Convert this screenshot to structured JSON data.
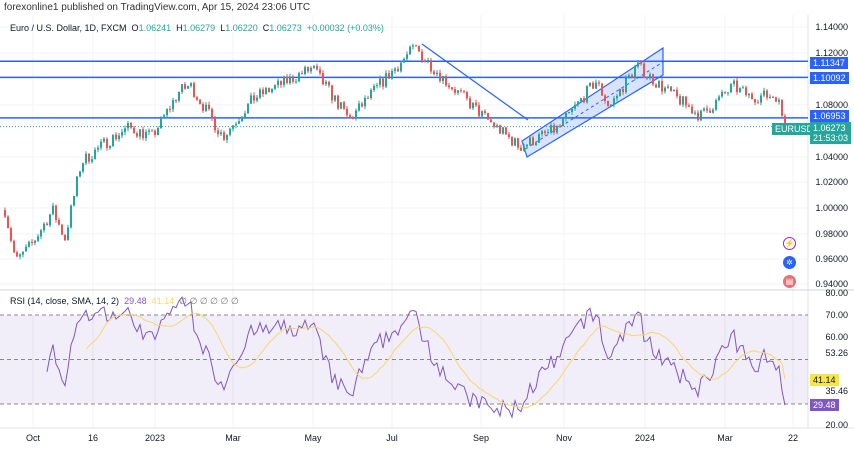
{
  "header": {
    "published": "forexonline1 published on TradingView.com, Apr 15, 2024 23:06 UTC"
  },
  "legend": {
    "symbol": "Euro / U.S. Dollar, 1D, FXCM",
    "o_label": "O",
    "o": "1.06241",
    "h_label": "H",
    "h": "1.06279",
    "l_label": "L",
    "l": "1.06220",
    "c_label": "C",
    "c": "1.06273",
    "change": "+0.00032 (+0.03%)"
  },
  "rsi_legend": {
    "label": "RSI (14, close, SMA, 14, 2)",
    "rsi": "29.48",
    "sma": "41.14",
    "na": "∅ ∅ ∅ ∅ ∅ ∅"
  },
  "price_axis": [
    "1.14000",
    "1.12000",
    "1.08000",
    "1.04000",
    "1.02000",
    "1.00000",
    "0.98000",
    "0.96000",
    "0.94000"
  ],
  "price_tags": {
    "level1": "1.11347",
    "level2": "1.10092",
    "level3": "1.06953",
    "symbol": "EURUSD",
    "last": "1.06273",
    "countdown": "21:53:03"
  },
  "rsi_axis": [
    "80.00",
    "70.00",
    "60.00",
    "53.26",
    "35.46",
    "20.00"
  ],
  "rsi_tags": {
    "sma": "41.14",
    "rsi": "29.48"
  },
  "time_axis": [
    "Oct",
    "16",
    "2023",
    "Mar",
    "May",
    "Jul",
    "Sep",
    "Nov",
    "2024",
    "Mar",
    "22"
  ],
  "colors": {
    "up": "#26a69a",
    "down": "#ef5350",
    "level": "#2962ff",
    "rsi": "#7e57c2",
    "sma": "#f5d76e"
  },
  "chart_data": {
    "type": "candlestick",
    "title": "Euro / U.S. Dollar, 1D, FXCM",
    "key_closes": [
      [
        "2022-09-20",
        0.998
      ],
      [
        "2022-09-28",
        0.958
      ],
      [
        "2022-10-10",
        0.972
      ],
      [
        "2022-10-25",
        0.998
      ],
      [
        "2022-11-03",
        0.976
      ],
      [
        "2022-11-15",
        1.035
      ],
      [
        "2022-12-05",
        1.052
      ],
      [
        "2022-12-20",
        1.062
      ],
      [
        "2023-01-06",
        1.055
      ],
      [
        "2023-01-26",
        1.09
      ],
      [
        "2023-02-03",
        1.095
      ],
      [
        "2023-02-27",
        1.055
      ],
      [
        "2023-03-22",
        1.085
      ],
      [
        "2023-04-26",
        1.104
      ],
      [
        "2023-05-04",
        1.108
      ],
      [
        "2023-05-31",
        1.068
      ],
      [
        "2023-06-22",
        1.095
      ],
      [
        "2023-07-18",
        1.124
      ],
      [
        "2023-08-10",
        1.098
      ],
      [
        "2023-09-05",
        1.072
      ],
      [
        "2023-10-03",
        1.047
      ],
      [
        "2023-11-01",
        1.062
      ],
      [
        "2023-11-28",
        1.098
      ],
      [
        "2023-12-08",
        1.078
      ],
      [
        "2023-12-28",
        1.11
      ],
      [
        "2024-01-15",
        1.094
      ],
      [
        "2024-02-13",
        1.071
      ],
      [
        "2024-03-08",
        1.094
      ],
      [
        "2024-03-20",
        1.086
      ],
      [
        "2024-04-09",
        1.087
      ],
      [
        "2024-04-15",
        1.0627
      ]
    ],
    "levels": [
      1.11347,
      1.10092,
      1.06953
    ],
    "ylim": [
      0.935,
      1.145
    ],
    "rsi": {
      "value": 29.48,
      "sma": 41.14,
      "bands": [
        70,
        50,
        30
      ],
      "ylim": [
        20,
        80
      ]
    }
  }
}
